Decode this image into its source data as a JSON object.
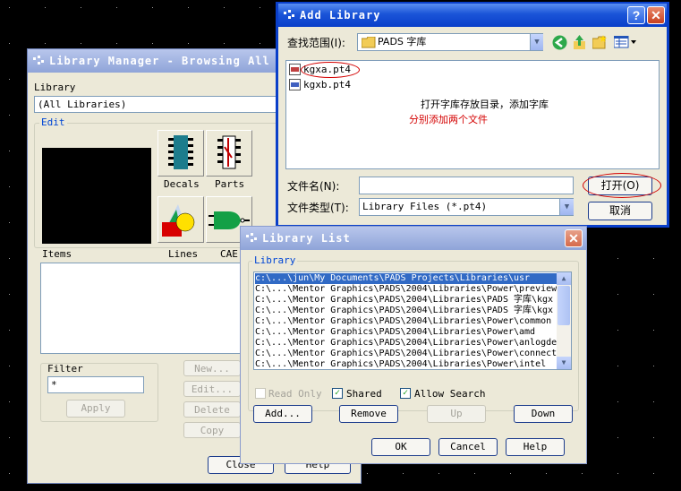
{
  "library_manager": {
    "title": "Library Manager - Browsing All ...",
    "library_label": "Library",
    "library_value": "(All Libraries)",
    "edit_label": "Edit",
    "decals_label": "Decals",
    "parts_label": "Parts",
    "lines_label": "Lines",
    "cae_label": "CAE",
    "items_label": "Items",
    "filter_label": "Filter",
    "filter_value": "*",
    "apply_label": "Apply",
    "new_label": "New...",
    "edit_btn_label": "Edit...",
    "delete_label": "Delete",
    "copy_label": "Copy",
    "close_label": "Close",
    "help_label": "Help"
  },
  "add_library": {
    "title": "Add Library",
    "lookin_label": "查找范围(I):",
    "lookin_value": "PADS 字库",
    "files": [
      "kgxa.pt4",
      "kgxb.pt4"
    ],
    "annotation_1": "打开字库存放目录，添加字库",
    "annotation_2": "分别添加两个文件",
    "filename_label": "文件名(N):",
    "filename_value": "",
    "filetype_label": "文件类型(T):",
    "filetype_value": "Library Files (*.pt4)",
    "open_label": "打开(O)",
    "cancel_label": "取消",
    "annotation_color": "#d40000"
  },
  "library_list": {
    "title": "Library List",
    "group_label": "Library",
    "items": [
      "c:\\...\\jun\\My Documents\\PADS Projects\\Libraries\\usr",
      "C:\\...\\Mentor Graphics\\PADS\\2004\\Libraries\\Power\\preview",
      "C:\\...\\Mentor Graphics\\PADS\\2004\\Libraries\\PADS 字库\\kgx",
      "C:\\...\\Mentor Graphics\\PADS\\2004\\Libraries\\PADS 字库\\kgx",
      "C:\\...\\Mentor Graphics\\PADS\\2004\\Libraries\\Power\\common",
      "C:\\...\\Mentor Graphics\\PADS\\2004\\Libraries\\Power\\amd",
      "C:\\...\\Mentor Graphics\\PADS\\2004\\Libraries\\Power\\anlogde",
      "C:\\...\\Mentor Graphics\\PADS\\2004\\Libraries\\Power\\connect",
      "C:\\...\\Mentor Graphics\\PADS\\2004\\Libraries\\Power\\intel"
    ],
    "read_only_label": "Read Only",
    "shared_label": "Shared",
    "allow_search_label": "Allow Search",
    "add_label": "Add...",
    "remove_label": "Remove",
    "up_label": "Up",
    "down_label": "Down",
    "ok_label": "OK",
    "cancel_label": "Cancel",
    "help_label": "Help"
  }
}
